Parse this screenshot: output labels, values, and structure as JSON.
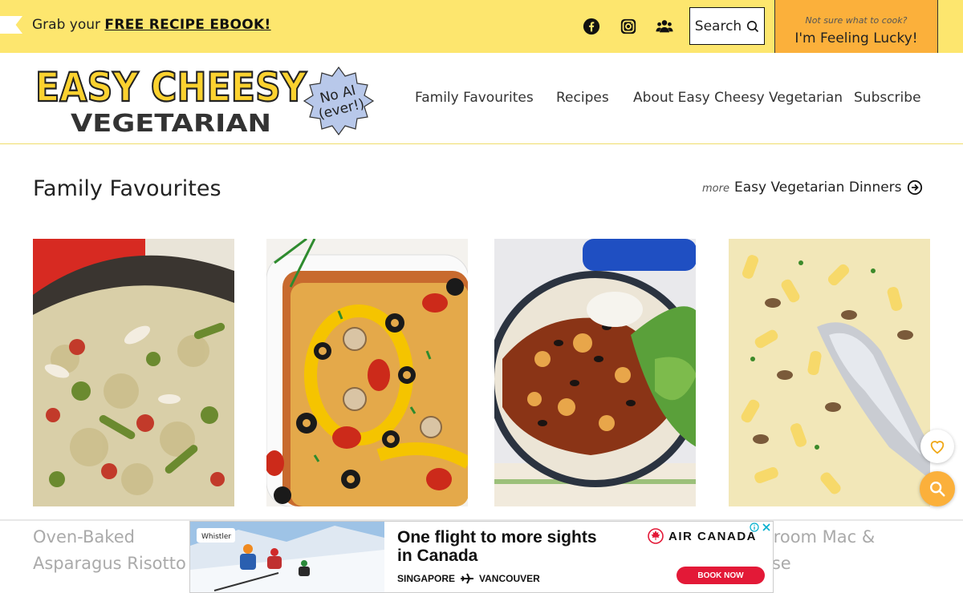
{
  "topbar": {
    "promo_prefix": "Grab your ",
    "promo_link": "FREE RECIPE EBOOK!",
    "search_label": "Search",
    "lucky_small": "Not sure what to cook?",
    "lucky_big": "I'm Feeling Lucky!",
    "social_icons": [
      "facebook-icon",
      "instagram-icon",
      "group-icon"
    ]
  },
  "logo": {
    "line1": "EASY CHEESY",
    "line2": "VEGETARIAN",
    "badge_line1": "No AI",
    "badge_line2": "(ever!)"
  },
  "nav": {
    "items": [
      "Family Favourites",
      "Recipes",
      "About Easy Cheesy Vegetarian",
      "Subscribe"
    ]
  },
  "main": {
    "section_title": "Family Favourites",
    "more_prefix": "more",
    "more_link": "Easy Vegetarian Dinners",
    "cards": [
      {
        "title": "Oven-Baked Asparagus Risotto"
      },
      {
        "title": ""
      },
      {
        "title": ""
      },
      {
        "title": "Mushroom Mac & Cheese"
      }
    ]
  },
  "ad": {
    "brand_tag": "Whistler",
    "headline_line1": "One flight to more sights",
    "headline_line2": "in Canada",
    "route_from": "SINGAPORE",
    "route_to": "VANCOUVER",
    "airline": "AIR CANADA",
    "cta": "BOOK NOW"
  },
  "colors": {
    "topbar": "#fde66e",
    "lucky": "#fbb03b",
    "logo_yellow": "#fcd22f",
    "badge": "#b8c8ea",
    "ad_red": "#e31937"
  }
}
